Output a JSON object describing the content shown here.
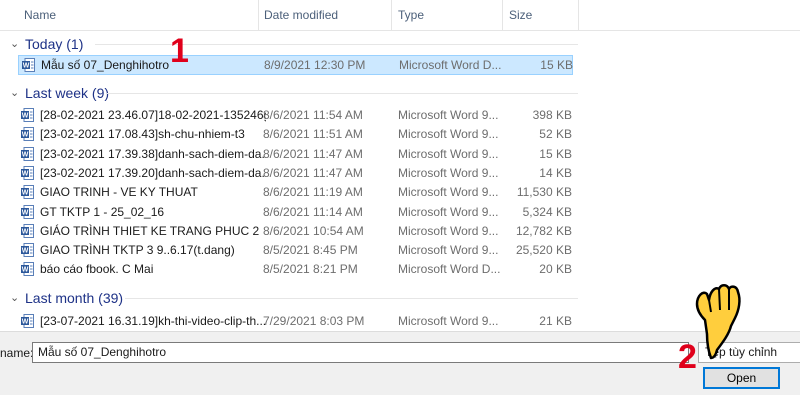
{
  "columns": {
    "name": "Name",
    "date": "Date modified",
    "type": "Type",
    "size": "Size"
  },
  "groups": [
    {
      "label": "Today (1)",
      "files": [
        {
          "name": "Mẫu số 07_Denghihotro",
          "date": "8/9/2021 12:30 PM",
          "type": "Microsoft Word D...",
          "size": "15 KB",
          "selected": true
        }
      ]
    },
    {
      "label": "Last week (9)",
      "files": [
        {
          "name": "[28-02-2021 23.46.07]18-02-2021-135246g...",
          "date": "8/6/2021 11:54 AM",
          "type": "Microsoft Word 9...",
          "size": "398 KB"
        },
        {
          "name": "[23-02-2021 17.08.43]sh-chu-nhiem-t3",
          "date": "8/6/2021 11:51 AM",
          "type": "Microsoft Word 9...",
          "size": "52 KB"
        },
        {
          "name": "[23-02-2021 17.39.38]danh-sach-diem-da...",
          "date": "8/6/2021 11:47 AM",
          "type": "Microsoft Word 9...",
          "size": "15 KB"
        },
        {
          "name": "[23-02-2021 17.39.20]danh-sach-diem-da...",
          "date": "8/6/2021 11:47 AM",
          "type": "Microsoft Word 9...",
          "size": "14 KB"
        },
        {
          "name": "GIAO TRINH - VE KY THUAT",
          "date": "8/6/2021 11:19 AM",
          "type": "Microsoft Word 9...",
          "size": "11,530 KB"
        },
        {
          "name": "GT TKTP 1 - 25_02_16",
          "date": "8/6/2021 11:14 AM",
          "type": "Microsoft Word 9...",
          "size": "5,324 KB"
        },
        {
          "name": "GIÁO TRÌNH THIET KE TRANG PHUC 2",
          "date": "8/6/2021 10:54 AM",
          "type": "Microsoft Word 9...",
          "size": "12,782 KB"
        },
        {
          "name": "GIAO TRÌNH TKTP 3  9..6.17(t.dang)",
          "date": "8/5/2021 8:45 PM",
          "type": "Microsoft Word 9...",
          "size": "25,520 KB"
        },
        {
          "name": "báo cáo fbook. C Mai",
          "date": "8/5/2021 8:21 PM",
          "type": "Microsoft Word D...",
          "size": "20 KB"
        }
      ]
    },
    {
      "label": "Last month (39)",
      "files": [
        {
          "name": "[23-07-2021 16.31.19]kh-thi-video-clip-th...",
          "date": "7/29/2021 8:03 PM",
          "type": "Microsoft Word 9...",
          "size": "21 KB"
        }
      ]
    }
  ],
  "bottom": {
    "filename_label": "name:",
    "filename_value": "Mẫu số 07_Denghihotro",
    "filetype_value": "Tệp tùy chỉnh",
    "open_label": "Open"
  },
  "annotations": {
    "step1": "1",
    "step2": "2"
  },
  "colors": {
    "accent": "#0078d7",
    "group": "#1e3287",
    "selection": "#cce8ff",
    "annotation": "#e0001b",
    "word_icon": "#2b579a"
  }
}
